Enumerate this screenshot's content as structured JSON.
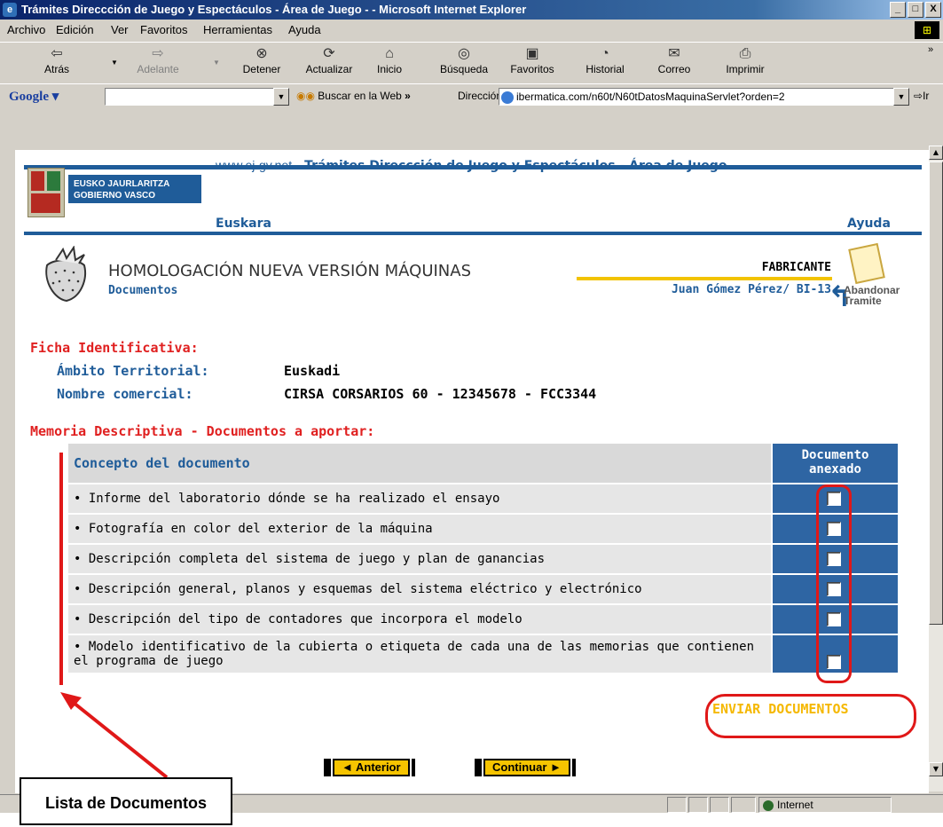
{
  "window": {
    "title": "Trámites Direccción de Juego y Espectáculos - Área de Juego - - Microsoft Internet Explorer",
    "controls": [
      "_",
      "□",
      "X"
    ]
  },
  "menu": [
    "Archivo",
    "Edición",
    "Ver",
    "Favoritos",
    "Herramientas",
    "Ayuda"
  ],
  "toolbar": {
    "back": "Atrás",
    "forward": "Adelante",
    "stop": "Detener",
    "refresh": "Actualizar",
    "home": "Inicio",
    "search": "Búsqueda",
    "favorites": "Favoritos",
    "history": "Historial",
    "mail": "Correo",
    "print": "Imprimir"
  },
  "google_bar": {
    "logo": "Google",
    "search_value": "",
    "search_web": "Buscar en la Web",
    "more": "»",
    "address_label": "Dirección",
    "address": "ibermatica.com/n60t/N60tDatosMaquinaServlet?orden=2",
    "go": "Ir"
  },
  "page": {
    "logo_line1": "EUSKO JAURLARITZA",
    "logo_line2": "GOBIERNO VASCO",
    "site": "www.ej-gv.net",
    "header_sep": " - ",
    "header_title": "Trámites Direccción de Juego y Espectáculos - Área de Juego",
    "euskara": "Euskara",
    "ayuda": "Ayuda",
    "title": "HOMOLOGACIÓN NUEVA VERSIÓN MÁQUINAS",
    "subtitle": "Documentos",
    "role": "FABRICANTE",
    "user": "Juan Gómez Pérez/ BI-13",
    "abandon_1": "Abandonar",
    "abandon_2": "Tramite",
    "ficha_heading": "Ficha Identificativa:",
    "ambito_label": "Ámbito Territorial:",
    "ambito_value": "Euskadi",
    "nombre_label": "Nombre comercial:",
    "nombre_value": "CIRSA CORSARIOS 60 - 12345678 - FCC3344",
    "memoria_heading": "Memoria Descriptiva - Documentos a aportar:",
    "table": {
      "col1": "Concepto del documento",
      "col2_line1": "Documento",
      "col2_line2": "anexado",
      "rows": [
        {
          "text": "• Informe del laboratorio dónde se ha realizado el ensayo",
          "checked": false
        },
        {
          "text": "• Fotografía en color del exterior de la máquina",
          "checked": false
        },
        {
          "text": "• Descripción completa del sistema de juego y plan de ganancias",
          "checked": false
        },
        {
          "text": "• Descripción general, planos y esquemas del sistema eléctrico y electrónico",
          "checked": false
        },
        {
          "text": "• Descripción del tipo de contadores que incorpora el modelo",
          "checked": false
        },
        {
          "text": "• Modelo identificativo de la cubierta o etiqueta de cada una de las memorias que contienen el programa de juego",
          "checked": false
        }
      ]
    },
    "send_button": "ENVIAR DOCUMENTOS",
    "prev_button": "◄ Anterior",
    "next_button": "Continuar ►"
  },
  "status": {
    "zone": "Internet"
  },
  "callout": "Lista de Documentos",
  "colors": {
    "brand_blue": "#1f5c99",
    "accent_red": "#e02020",
    "accent_yellow": "#f5b800"
  }
}
